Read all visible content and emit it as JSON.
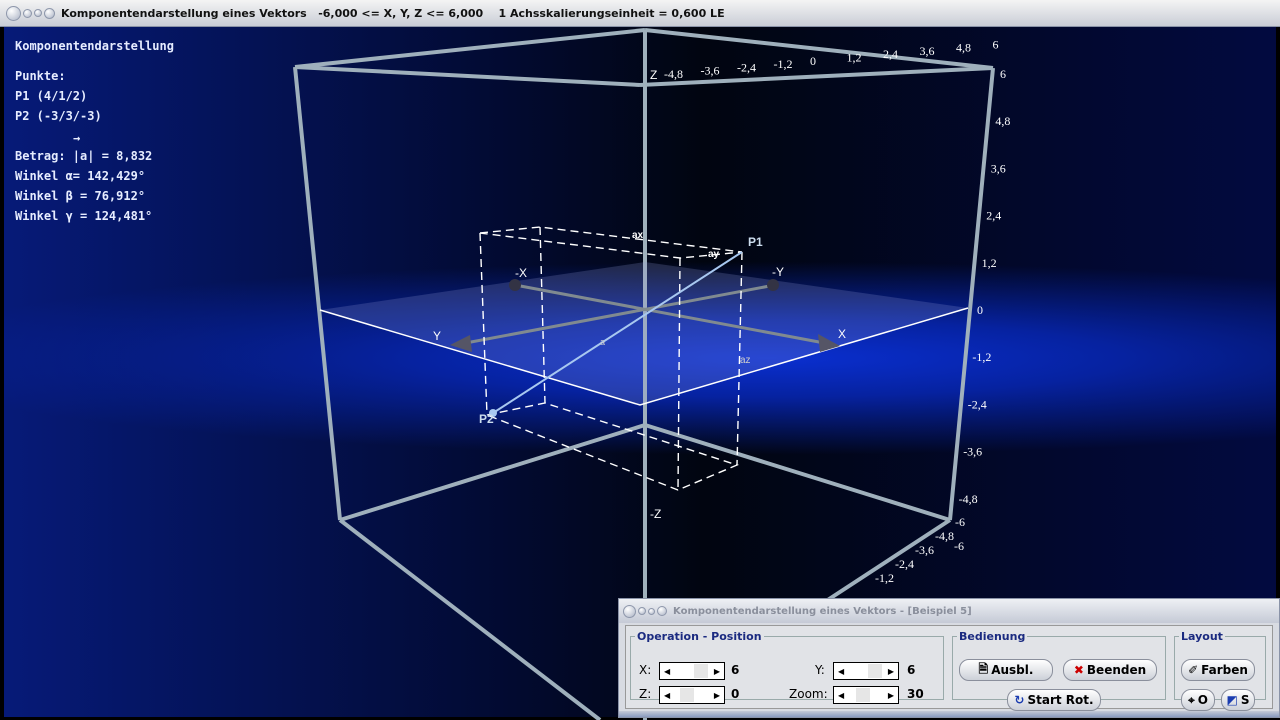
{
  "window": {
    "title": "Komponentendarstellung eines Vektors   -6,000 <= X, Y, Z <= 6,000    1 Achsskalierungseinheit = 0,600 LE"
  },
  "info": {
    "heading": "Komponentendarstellung",
    "points_label": "Punkte:",
    "p1": "P1 (4/1/2)",
    "p2": "P2 (-3/3/-3)",
    "vector_arrow": "→",
    "betrag": "Betrag: |a| = 8,832",
    "alpha": "Winkel α= 142,429°",
    "beta": "Winkel β = 76,912°",
    "gamma": "Winkel γ = 124,481°"
  },
  "scene": {
    "axis_labels": {
      "x": "X",
      "neg_x": "-X",
      "y": "Y",
      "neg_y": "-Y",
      "z": "Z",
      "neg_z": "-Z"
    },
    "point_labels": {
      "p1": "P1",
      "p2": "P2"
    },
    "component_labels": {
      "ax": "ax",
      "ay": "ay",
      "az": "az",
      "a": "a"
    },
    "top_ticks": [
      "-4,8",
      "-3,6",
      "-2,4",
      "-1,2",
      "0",
      "1,2",
      "2,4",
      "3,6",
      "4,8",
      "6"
    ],
    "right_ticks": [
      "6",
      "4,8",
      "3,6",
      "2,4",
      "1,2",
      "0",
      "-1,2",
      "-2,4",
      "-3,6",
      "-4,8",
      "-6"
    ],
    "bottom_ticks": [
      "-6",
      "-4,8",
      "-3,6",
      "-2,4",
      "-1,2"
    ],
    "colors": {
      "frame": "#9fb0bc",
      "vector": "#a8c8f0",
      "background": "#061a78"
    }
  },
  "panel": {
    "title": "Komponentendarstellung eines Vektors - [Beispiel 5]",
    "operation": {
      "legend": "Operation - Position",
      "x_label": "X:",
      "x_value": "6",
      "y_label": "Y:",
      "y_value": "6",
      "z_label": "Z:",
      "z_value": "0",
      "zoom_label": "Zoom:",
      "zoom_value": "30"
    },
    "bedienung": {
      "legend": "Bedienung",
      "ausbl": "Ausbl.",
      "beenden": "Beenden",
      "start_rot": "Start Rot."
    },
    "layout": {
      "legend": "Layout",
      "farben": "Farben",
      "o": "O",
      "s": "S"
    }
  }
}
